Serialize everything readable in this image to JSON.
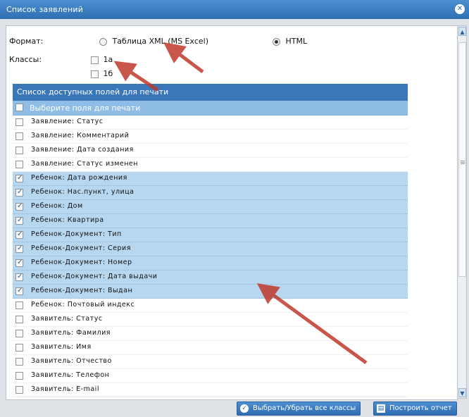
{
  "dialog": {
    "title": "Список заявлений"
  },
  "form": {
    "format_label": "Формат:",
    "format_options": [
      {
        "label": "Таблица XML (MS Excel)",
        "selected": false
      },
      {
        "label": "HTML",
        "selected": true
      }
    ],
    "classes_label": "Классы:",
    "classes": [
      {
        "label": "1а",
        "checked": false
      },
      {
        "label": "1б",
        "checked": false
      }
    ]
  },
  "fields_panel": {
    "title": "Список доступных полей для печати",
    "header_label": "Выберите поля для печати",
    "items": [
      {
        "label": "Заявление: Статус",
        "checked": false
      },
      {
        "label": "Заявление: Комментарий",
        "checked": false
      },
      {
        "label": "Заявление: Дата создания",
        "checked": false
      },
      {
        "label": "Заявление: Статус изменен",
        "checked": false
      },
      {
        "label": "Ребенок: Дата рождения",
        "checked": true
      },
      {
        "label": "Ребенок: Нас.пункт, улица",
        "checked": true
      },
      {
        "label": "Ребенок: Дом",
        "checked": true
      },
      {
        "label": "Ребенок: Квартира",
        "checked": true
      },
      {
        "label": "Ребенок-Документ: Тип",
        "checked": true
      },
      {
        "label": "Ребенок-Документ: Серия",
        "checked": true
      },
      {
        "label": "Ребенок-Документ: Номер",
        "checked": true
      },
      {
        "label": "Ребенок-Документ: Дата выдачи",
        "checked": true
      },
      {
        "label": "Ребенок-Документ: Выдан",
        "checked": true
      },
      {
        "label": "Ребенок: Почтовый индекс",
        "checked": false
      },
      {
        "label": "Заявитель: Статус",
        "checked": false
      },
      {
        "label": "Заявитель: Фамилия",
        "checked": false
      },
      {
        "label": "Заявитель: Имя",
        "checked": false
      },
      {
        "label": "Заявитель: Отчество",
        "checked": false
      },
      {
        "label": "Заявитель: Телефон",
        "checked": false
      },
      {
        "label": "Заявитель: E-mail",
        "checked": false
      }
    ]
  },
  "buttons": {
    "toggle_classes": "Выбрать/Убрать все классы",
    "build_report": "Построить отчет"
  },
  "colors": {
    "titlebar": "#2f6fb3",
    "panel_header": "#3977b8",
    "list_header": "#8fbde6",
    "selected_row": "#b7d6f0",
    "annotation_arrow": "#c0392b"
  }
}
